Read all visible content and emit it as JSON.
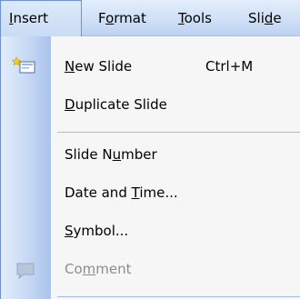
{
  "menubar": {
    "items": [
      {
        "pre": "",
        "ul": "I",
        "post": "nsert",
        "state": "open"
      },
      {
        "pre": "F",
        "ul": "o",
        "post": "rmat",
        "state": "closed"
      },
      {
        "pre": "",
        "ul": "T",
        "post": "ools",
        "state": "closed"
      },
      {
        "pre": "Sli",
        "ul": "d",
        "post": "e",
        "state": "closed"
      }
    ]
  },
  "dropdown": {
    "items": [
      {
        "pre": "",
        "ul": "N",
        "post": "ew Slide",
        "shortcut": "Ctrl+M",
        "icon": "new-slide-icon",
        "enabled": true
      },
      {
        "pre": "",
        "ul": "D",
        "post": "uplicate Slide",
        "shortcut": "",
        "icon": "",
        "enabled": true
      },
      {
        "pre": "Slide N",
        "ul": "u",
        "post": "mber",
        "shortcut": "",
        "icon": "",
        "enabled": true
      },
      {
        "pre": "Date and ",
        "ul": "T",
        "post": "ime...",
        "shortcut": "",
        "icon": "",
        "enabled": true
      },
      {
        "pre": "",
        "ul": "S",
        "post": "ymbol...",
        "shortcut": "",
        "icon": "",
        "enabled": true
      },
      {
        "pre": "Co",
        "ul": "m",
        "post": "ment",
        "shortcut": "",
        "icon": "comment-icon",
        "enabled": false
      }
    ]
  },
  "colors": {
    "gutter": "#c6d8f4",
    "separator": "#a6bde3",
    "menu_bg": "#f6f6f6",
    "disabled_text": "#8c8c8c",
    "active_border": "#6f92c8"
  }
}
